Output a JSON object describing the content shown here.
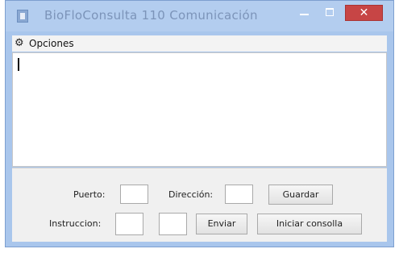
{
  "window": {
    "title": "BioFloConsulta 110  Comunicación",
    "close_glyph": "✕",
    "icons": [
      "app-icon",
      "minimize-icon",
      "maximize-icon",
      "close-icon"
    ]
  },
  "menu": {
    "items": [
      {
        "label": "Opciones",
        "icon": "gear-icon",
        "glyph": "⚙"
      }
    ]
  },
  "console": {
    "text": ""
  },
  "controls": {
    "puerto_label": "Puerto:",
    "puerto_value": "",
    "direccion_label": "Dirección:",
    "direccion_value": "",
    "guardar_label": "Guardar",
    "instruccion_label": "Instruccion:",
    "instruccion_value_1": "",
    "instruccion_value_2": "",
    "enviar_label": "Enviar",
    "iniciar_consola_label": "Iniciar consolla"
  },
  "colors": {
    "titlebar": "#b3cdef",
    "close_button": "#c74545",
    "panel": "#f0f0f0"
  }
}
